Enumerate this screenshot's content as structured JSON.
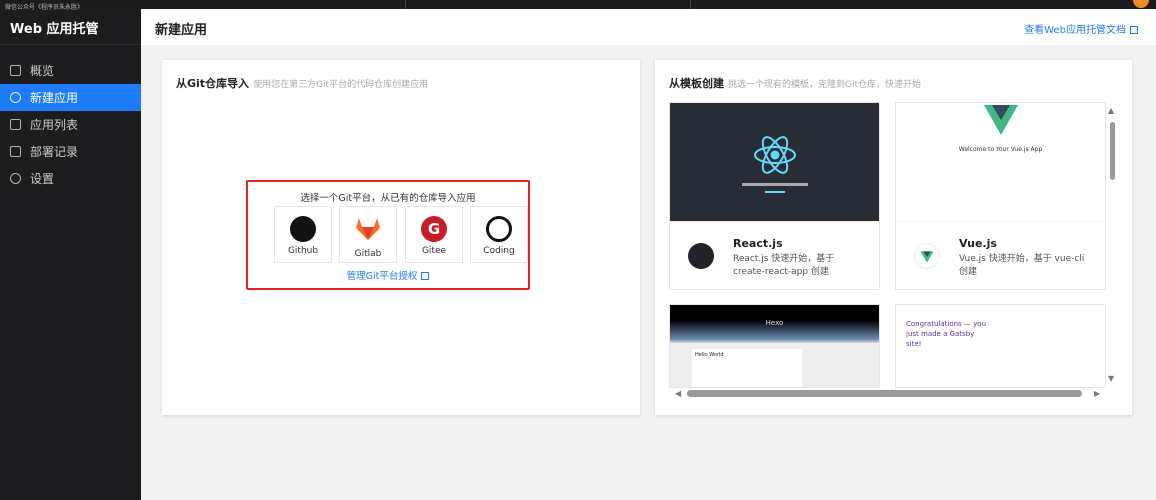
{
  "watermark": "微信公众号《程序员朱永胜》",
  "sidebar": {
    "title": "Web 应用托管",
    "items": [
      {
        "label": "概览"
      },
      {
        "label": "新建应用"
      },
      {
        "label": "应用列表"
      },
      {
        "label": "部署记录"
      },
      {
        "label": "设置"
      }
    ]
  },
  "header": {
    "title": "新建应用",
    "docs_link": "查看Web应用托管文档"
  },
  "git_import": {
    "title": "从Git仓库导入",
    "subtitle": "使用您在第三方Git平台的代码仓库创建应用",
    "prompt": "选择一个Git平台，从已有的仓库导入应用",
    "platforms": [
      {
        "label": "Github"
      },
      {
        "label": "Gitlab"
      },
      {
        "label": "Gitee"
      },
      {
        "label": "Coding"
      }
    ],
    "manage_link": "管理Git平台授权"
  },
  "templates": {
    "title": "从模板创建",
    "subtitle": "挑选一个现有的模板，克隆到Git仓库，快速开始",
    "items": [
      {
        "name": "React.js",
        "desc": "React.js 快速开始，基于 create-react-app 创建"
      },
      {
        "name": "Vue.js",
        "desc": "Vue.js 快速开始，基于 vue-cli 创建"
      }
    ],
    "previews": {
      "vue_welcome": "Welcome to Your Vue.js App",
      "hexo": "Hexo",
      "hexo_post": "Hello World",
      "gatsby": "Congratulations — you just made a Gatsby site!"
    }
  },
  "colors": {
    "accent": "#1f7cf9",
    "highlight": "#e02424"
  }
}
